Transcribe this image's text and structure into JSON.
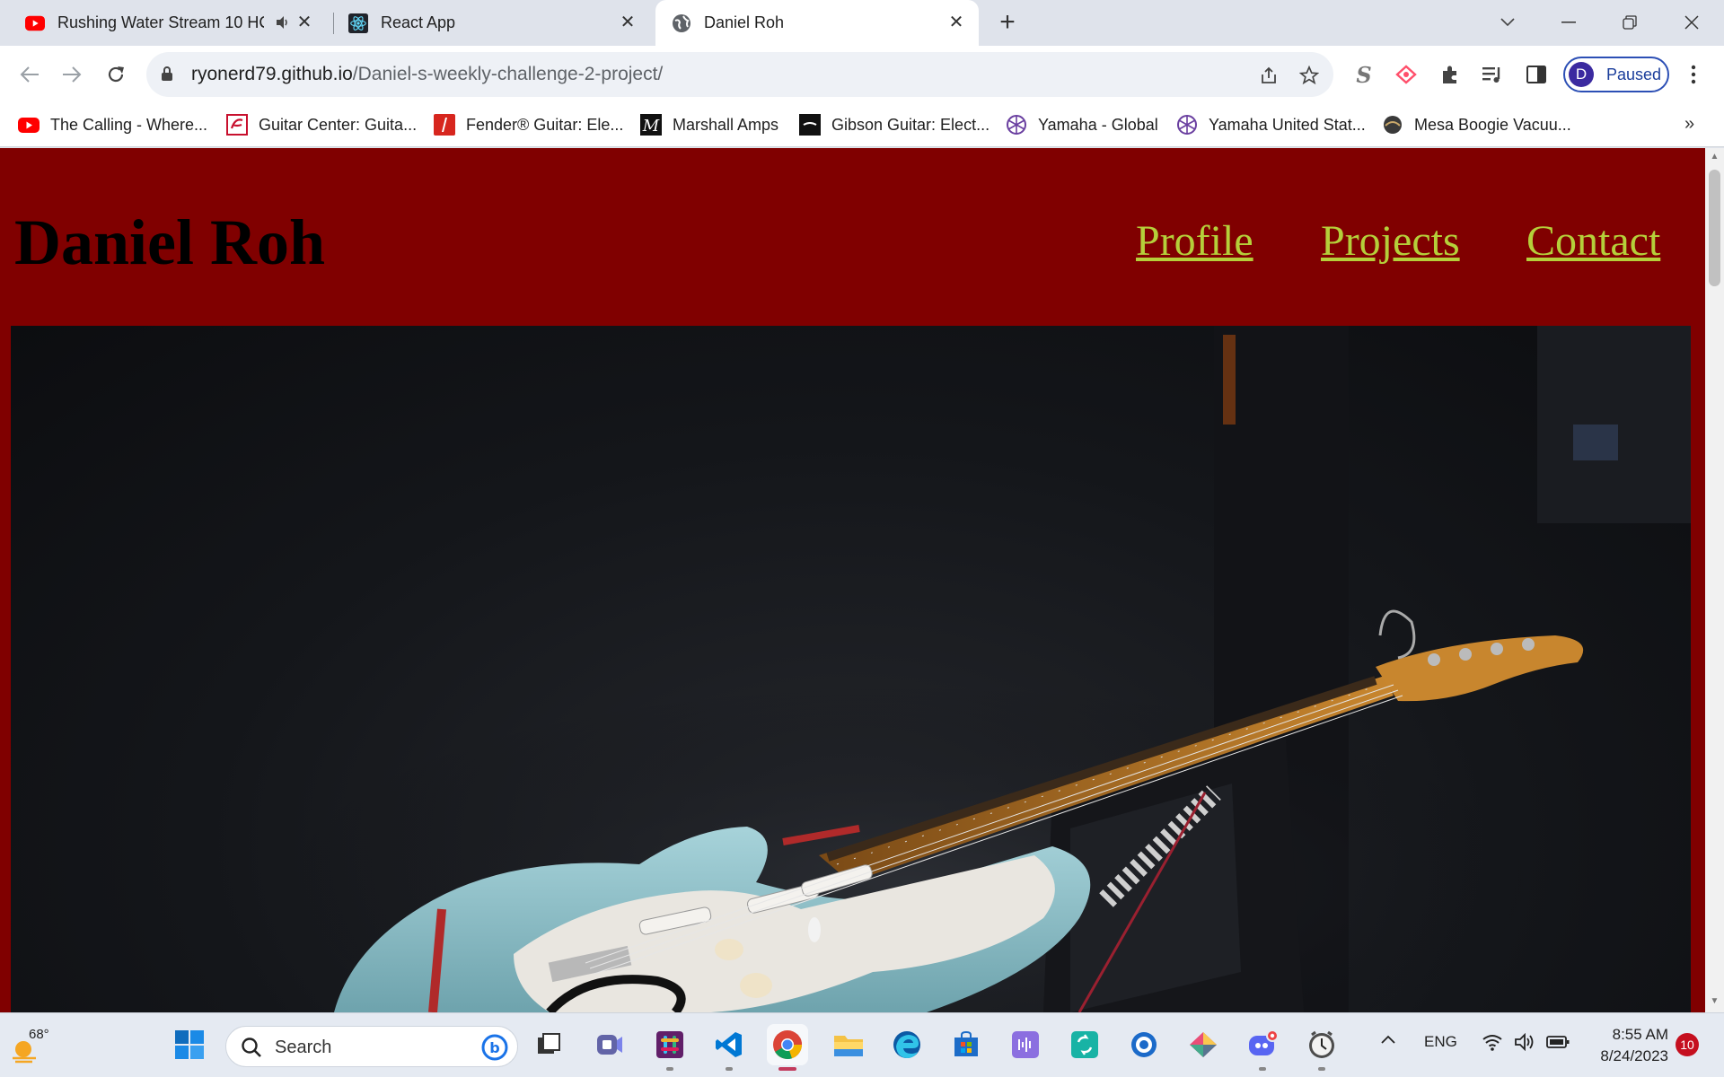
{
  "tabs": [
    {
      "title": "Rushing Water Stream 10 HC",
      "favicon": "youtube-icon",
      "muted_audio": true
    },
    {
      "title": "React App",
      "favicon": "react-icon"
    },
    {
      "title": "Daniel Roh",
      "favicon": "globe-icon",
      "active": true
    }
  ],
  "toolbar": {
    "url_host": "ryonerd79.github.io",
    "url_path": "/Daniel-s-weekly-challenge-2-project/",
    "profile_initial": "D",
    "profile_status": "Paused"
  },
  "bookmarks": {
    "items": [
      {
        "label": "The Calling - Where...",
        "icon": "youtube-icon"
      },
      {
        "label": "Guitar Center: Guita...",
        "icon": "guitar-center-icon"
      },
      {
        "label": "Fender® Guitar: Ele...",
        "icon": "fender-icon"
      },
      {
        "label": "Marshall Amps",
        "icon": "marshall-icon"
      },
      {
        "label": "Gibson Guitar: Elect...",
        "icon": "gibson-icon"
      },
      {
        "label": "Yamaha - Global",
        "icon": "yamaha-icon"
      },
      {
        "label": "Yamaha United Stat...",
        "icon": "yamaha-icon"
      },
      {
        "label": "Mesa Boogie Vacuu...",
        "icon": "mesa-boogie-icon"
      }
    ],
    "more": "»"
  },
  "site": {
    "name": "Daniel Roh",
    "nav": [
      "Profile",
      "Projects",
      "Contact"
    ],
    "colors": {
      "header_bg": "#800000",
      "nav_link": "#b5cf3a",
      "name": "#000000"
    },
    "hero_image": "electric guitar resting on amplifier"
  },
  "taskbar": {
    "weather_temp": "68°",
    "search_label": "Search",
    "apps": [
      "start-icon",
      "search-icon",
      "task-view-icon",
      "teams-icon",
      "slack-icon",
      "vscode-icon",
      "chrome-icon",
      "file-explorer-icon",
      "edge-icon",
      "store-icon",
      "app-icon",
      "sync-app-icon",
      "circle-app-icon",
      "gitkraken-icon",
      "discord-icon",
      "clock-app-icon"
    ],
    "language": "ENG",
    "time": "8:55 AM",
    "date": "8/24/2023",
    "notifications": "10"
  }
}
